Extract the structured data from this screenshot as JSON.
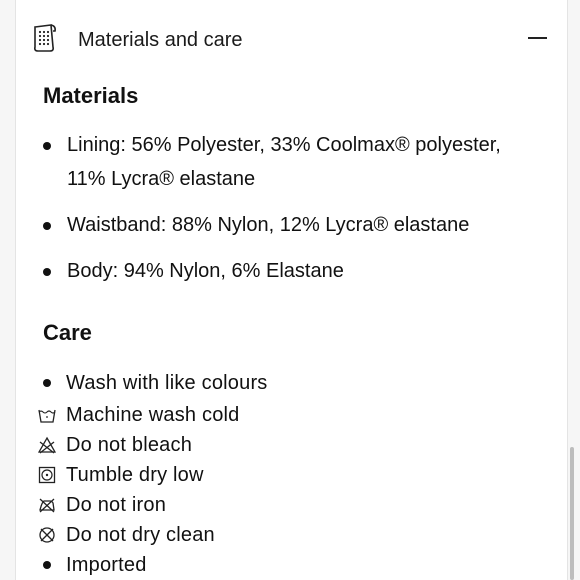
{
  "accordion": {
    "title": "Materials and care",
    "icon": "fabric-swatch-icon",
    "toggle_icon": "minus-icon"
  },
  "materials": {
    "heading": "Materials",
    "items": [
      "Lining: 56% Polyester, 33% Coolmax® polyester, 11% Lycra® elastane",
      "Waistband: 88% Nylon, 12% Lycra® elastane",
      "Body: 94% Nylon, 6% Elastane"
    ]
  },
  "care": {
    "heading": "Care",
    "items": [
      {
        "icon": "bullet",
        "label": "Wash with like colours"
      },
      {
        "icon": "machine-wash-cold-icon",
        "label": "Machine wash cold"
      },
      {
        "icon": "do-not-bleach-icon",
        "label": "Do not bleach"
      },
      {
        "icon": "tumble-dry-low-icon",
        "label": "Tumble dry low"
      },
      {
        "icon": "do-not-iron-icon",
        "label": "Do not iron"
      },
      {
        "icon": "do-not-dry-clean-icon",
        "label": "Do not dry clean"
      },
      {
        "icon": "bullet",
        "label": "Imported"
      }
    ]
  }
}
